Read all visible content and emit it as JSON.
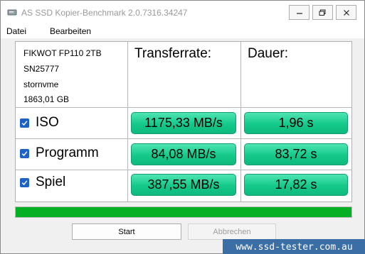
{
  "window": {
    "title": "AS SSD Kopier-Benchmark 2.0.7316.34247"
  },
  "menu": {
    "items": [
      "Datei",
      "Bearbeiten"
    ]
  },
  "device": {
    "model": "FIKWOT FP110 2TB",
    "serial": "SN25777",
    "driver": "stornvme",
    "size": "1863,01 GB"
  },
  "headers": {
    "transfer": "Transferrate:",
    "duration": "Dauer:"
  },
  "rows": [
    {
      "label": "ISO",
      "checked": true,
      "transfer": "1175,33 MB/s",
      "duration": "1,96 s"
    },
    {
      "label": "Programm",
      "checked": true,
      "transfer": "84,08 MB/s",
      "duration": "83,72 s"
    },
    {
      "label": "Spiel",
      "checked": true,
      "transfer": "387,55 MB/s",
      "duration": "17,82 s"
    }
  ],
  "progress": {
    "value": 1.0,
    "color": "#06b025"
  },
  "buttons": {
    "start": "Start",
    "abort": "Abbrechen"
  },
  "watermark": "www.ssd-tester.com.au",
  "colors": {
    "result_green": "#14c98a",
    "checkbox_blue": "#1e62c4"
  }
}
